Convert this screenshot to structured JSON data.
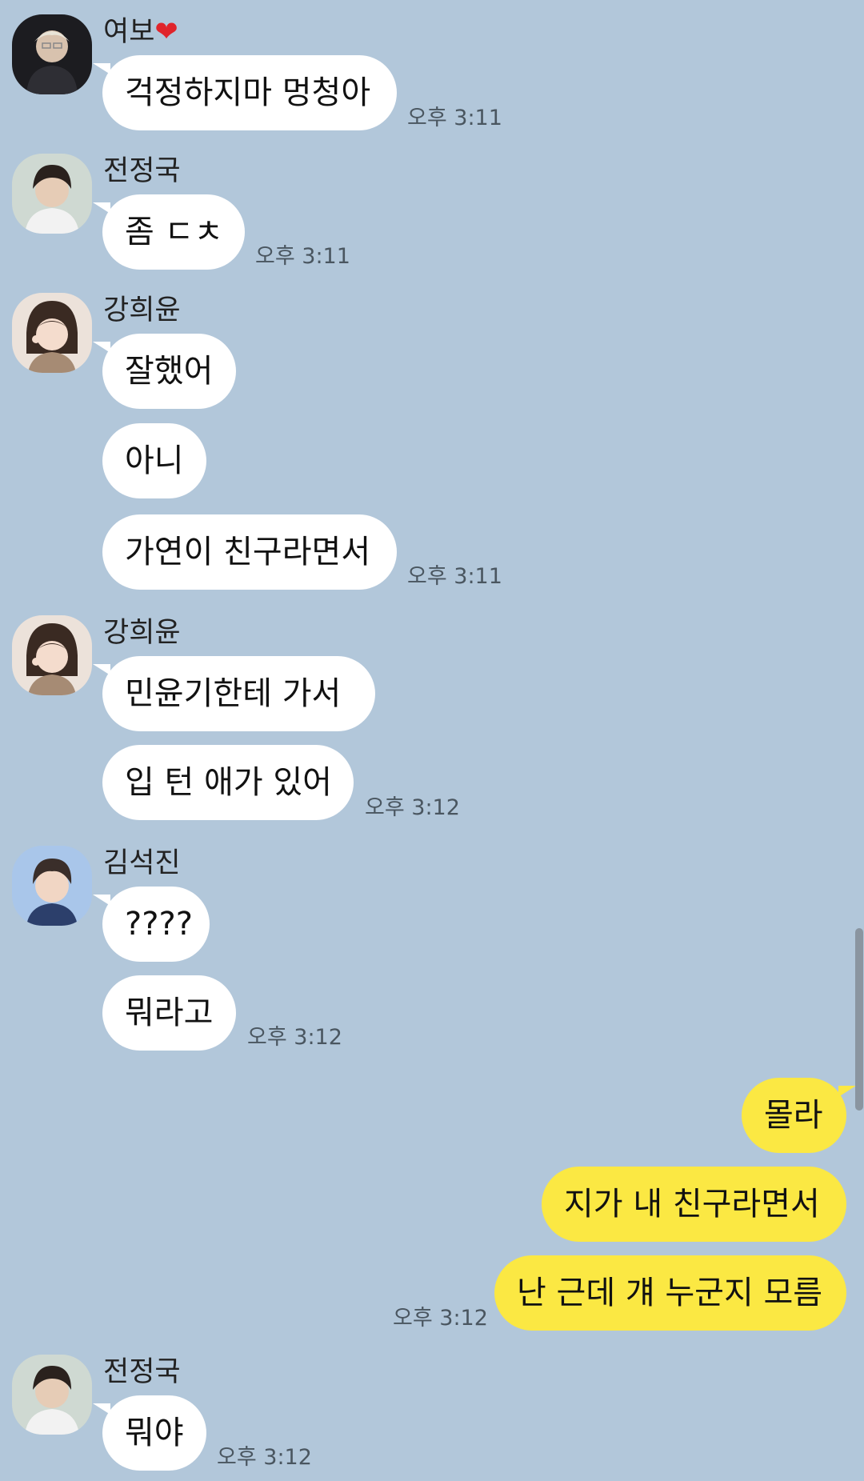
{
  "colors": {
    "background": "#b2c7da",
    "incoming_bubble": "#ffffff",
    "outgoing_bubble": "#fbe843"
  },
  "messages": [
    {
      "sender": "여보",
      "heart_icon": "red-heart-icon",
      "text": "걱정하지마 멍청아",
      "time": "오후 3:11"
    },
    {
      "sender": "전정국",
      "text": "좀 ㄷㅊ",
      "time": "오후 3:11"
    },
    {
      "sender": "강희윤",
      "texts": [
        "잘했어",
        "아니",
        "가연이 친구라면서"
      ],
      "time": "오후 3:11"
    },
    {
      "sender": "강희윤",
      "texts": [
        "민윤기한테 가서",
        "입 턴 애가 있어"
      ],
      "time": "오후 3:12"
    },
    {
      "sender": "김석진",
      "texts": [
        "????",
        "뭐라고"
      ],
      "time": "오후 3:12"
    },
    {
      "sender": "me",
      "texts": [
        "몰라",
        "지가 내 친구라면서",
        "난 근데 걔 누군지 모름"
      ],
      "time": "오후 3:12"
    },
    {
      "sender": "전정국",
      "text": "뭐야",
      "time": "오후 3:12"
    }
  ]
}
